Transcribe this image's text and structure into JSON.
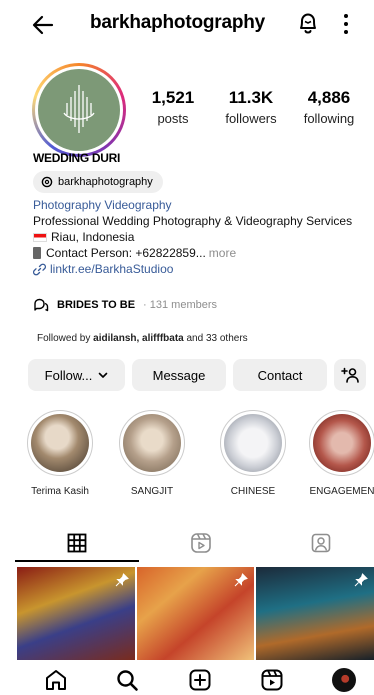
{
  "header": {
    "username": "barkhaphotography"
  },
  "profile": {
    "stats": [
      {
        "count": "1,521",
        "label": "posts"
      },
      {
        "count": "11.3K",
        "label": "followers"
      },
      {
        "count": "4,886",
        "label": "following"
      }
    ],
    "display_name": "WEDDING DURI",
    "threads_handle": "barkhaphotography",
    "category": "Photography Videography",
    "bio_line1": "Professional Wedding Photography & Videography Services",
    "bio_location": "Riau, Indonesia",
    "bio_contact": "Contact Person: +62822859...",
    "bio_more": "more",
    "link": "linktr.ee/BarkhaStudioo"
  },
  "community": {
    "name": "BRIDES TO BE",
    "members": "· 131 members"
  },
  "followed_by": {
    "prefix": "Followed by",
    "names": "aidilansh, alifffbata",
    "suffix": "and 33 others"
  },
  "actions": {
    "follow": "Follow...",
    "message": "Message",
    "contact": "Contact"
  },
  "highlights": [
    {
      "label": "Terima Kasih"
    },
    {
      "label": "SANGJIT"
    },
    {
      "label": "CHINESE"
    },
    {
      "label": "ENGAGEMEN"
    }
  ],
  "icons": {
    "back": "back-arrow-icon",
    "bell": "bell-icon",
    "more": "more-vertical-icon",
    "grid": "grid-icon",
    "reels": "reels-icon",
    "tagged": "tagged-icon",
    "home": "home-icon",
    "search": "search-icon",
    "create": "create-icon"
  }
}
